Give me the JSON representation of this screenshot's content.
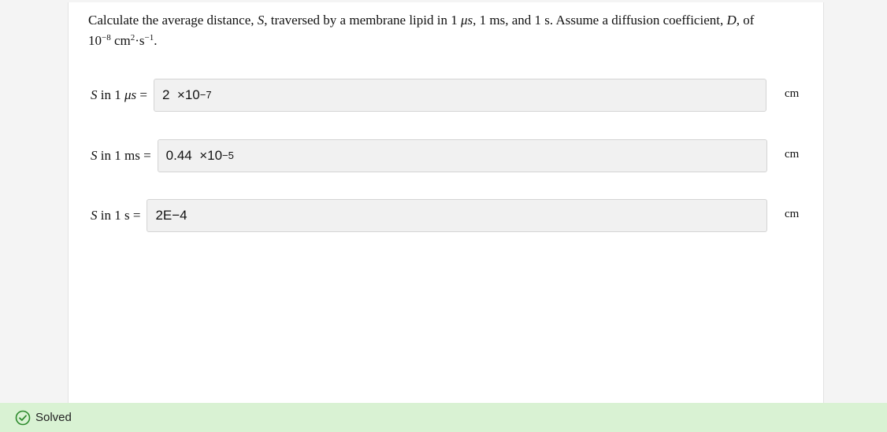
{
  "question": {
    "prefix": "Calculate the average distance, ",
    "var_s": "S",
    "middle": ", traversed by a membrane lipid in 1 ",
    "mu_s": "μs",
    "times": ", 1 ms, and 1 s. Assume a diffusion coefficient, ",
    "var_d": "D",
    "suffix": ", of",
    "coef_base": "10",
    "coef_exp": "−8",
    "coef_unit_a": " cm",
    "coef_unit_a_exp": "2",
    "coef_unit_b": "·s",
    "coef_unit_b_exp": "−1",
    "end": "."
  },
  "answers": [
    {
      "var": "S",
      "label_rest": " in 1 ",
      "label_unit": "μs",
      "label_eq": " =",
      "mantissa": "2  ×10",
      "exponent": "−7",
      "unit": "cm"
    },
    {
      "var": "S",
      "label_rest": " in 1 ",
      "label_unit": "ms",
      "label_eq": " =",
      "mantissa": "0.44  ×10",
      "exponent": "−5",
      "unit": "cm"
    },
    {
      "var": "S",
      "label_rest": " in 1 ",
      "label_unit": "s",
      "label_eq": " =",
      "value": "2E−4",
      "unit": "cm"
    }
  ],
  "status": {
    "text": "Solved",
    "icon": "check-circle-icon",
    "color": "#2e8b2e",
    "background": "#d9f2d3"
  }
}
